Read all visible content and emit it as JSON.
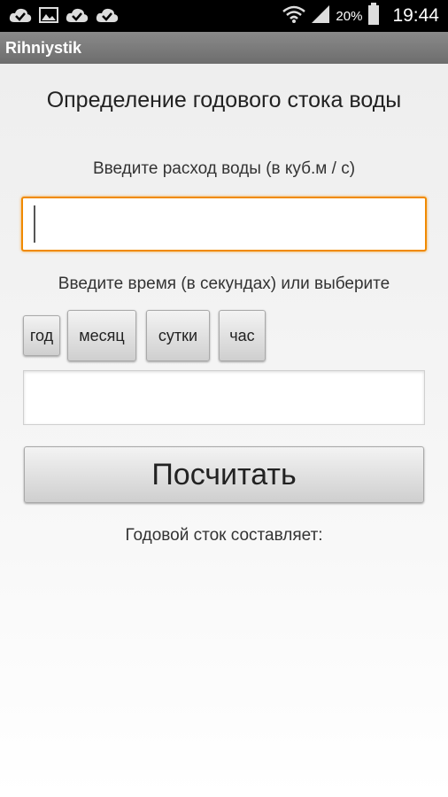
{
  "status_bar": {
    "battery": "20%",
    "time": "19:44",
    "left_icons": [
      "cloud-check-icon",
      "image-icon",
      "cloud-check-icon",
      "cloud-check-icon"
    ],
    "right_icons": [
      "wifi-icon",
      "signal-icon",
      "battery-icon"
    ]
  },
  "app_bar": {
    "title": "Rihniystik"
  },
  "main": {
    "heading": "Определение годового стока воды",
    "flow_label": "Введите расход воды (в куб.м / с)",
    "flow_input": {
      "value": "",
      "placeholder": ""
    },
    "time_label": "Введите время (в секундах) или выберите",
    "time_buttons": [
      "год",
      "месяц",
      "сутки",
      "час"
    ],
    "time_input": {
      "value": "",
      "placeholder": ""
    },
    "calculate_label": "Посчитать",
    "result_label": "Годовой сток составляет:"
  },
  "colors": {
    "focus": "#f08a00",
    "status_bar": "#000000",
    "action_bar": "#7a7a7a"
  }
}
